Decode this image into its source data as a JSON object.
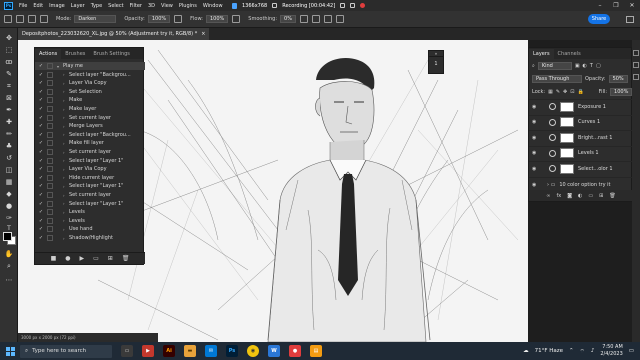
{
  "menubar": {
    "logo": "Ps",
    "items": [
      "File",
      "Edit",
      "Image",
      "Layer",
      "Type",
      "Select",
      "Filter",
      "3D",
      "View",
      "Plugins",
      "Window"
    ],
    "recorder": {
      "size": "1366x768",
      "title": "Recording [00:04:42]"
    }
  },
  "options": {
    "mode_label": "Mode:",
    "mode_value": "Darken",
    "opacity_label": "Opacity:",
    "opacity_value": "100%",
    "flow_label": "Flow:",
    "flow_value": "100%",
    "smoothing_label": "Smoothing:",
    "smoothing_value": "0%",
    "share_label": "Share"
  },
  "document": {
    "tab_title": "Depositphotos_223032620_XL.jpg @ 50% (Adjustment try it, RGB/8) *",
    "close": "×"
  },
  "actions_panel": {
    "tabs": [
      "Actions",
      "Brushes",
      "Brush Settings"
    ],
    "items": [
      {
        "label": "Play me",
        "indent": 0
      },
      {
        "label": "Select layer \"Backgrou...",
        "indent": 1
      },
      {
        "label": "Layer Via Copy",
        "indent": 1
      },
      {
        "label": "Set Selection",
        "indent": 1
      },
      {
        "label": "Make",
        "indent": 1
      },
      {
        "label": "Make layer",
        "indent": 1
      },
      {
        "label": "Set current layer",
        "indent": 1
      },
      {
        "label": "Merge Layers",
        "indent": 1
      },
      {
        "label": "Select layer \"Backgrou...",
        "indent": 1
      },
      {
        "label": "Make fill layer",
        "indent": 1
      },
      {
        "label": "Set current layer",
        "indent": 1
      },
      {
        "label": "Select layer \"Layer 1\"",
        "indent": 1
      },
      {
        "label": "Layer Via Copy",
        "indent": 1
      },
      {
        "label": "Hide current layer",
        "indent": 1
      },
      {
        "label": "Select layer \"Layer 1\"",
        "indent": 1
      },
      {
        "label": "Set current layer",
        "indent": 1
      },
      {
        "label": "Select layer \"Layer 1\"",
        "indent": 1
      },
      {
        "label": "Levels",
        "indent": 1
      },
      {
        "label": "Levels",
        "indent": 1
      },
      {
        "label": "Use hand",
        "indent": 1
      },
      {
        "label": "Shadow/Highlight",
        "indent": 1
      }
    ],
    "footer_icons": [
      "stop-icon",
      "record-icon",
      "play-icon",
      "folder-icon",
      "new-action-icon",
      "trash-icon"
    ]
  },
  "mini_panel": {
    "label": "1"
  },
  "layers_panel": {
    "tabs": [
      "Layers",
      "Channels"
    ],
    "filter_value": "Kind",
    "blend_value": "Pass Through",
    "opacity_label": "Opacity:",
    "opacity_value": "50%",
    "lock_label": "Lock:",
    "fill_label": "Fill:",
    "fill_value": "100%",
    "layers": [
      {
        "name": "Exposure 1",
        "mask_color": "#ffffff"
      },
      {
        "name": "Curves 1",
        "mask_color": "#ffffff"
      },
      {
        "name": "Bright...rast 1",
        "mask_color": "#ffffff"
      },
      {
        "name": "Levels 1",
        "mask_color": "#ffffff"
      },
      {
        "name": "Select...olor 1",
        "mask_color": "#ffffff"
      },
      {
        "name": "10 color option try it",
        "mask_color": ""
      }
    ]
  },
  "status": {
    "text": "3000 px x 2000 px (72 ppi)"
  },
  "taskbar": {
    "search_placeholder": "Type here to search",
    "apps": [
      {
        "name": "illustrator",
        "label": "Ai",
        "color": "#ff9a00",
        "bg": "#330000"
      },
      {
        "name": "photoshop",
        "label": "Ps",
        "color": "#31a8ff",
        "bg": "#001e36"
      }
    ],
    "weather": "71°F  Haze",
    "time": "7:50 AM",
    "date": "2/4/2023"
  }
}
